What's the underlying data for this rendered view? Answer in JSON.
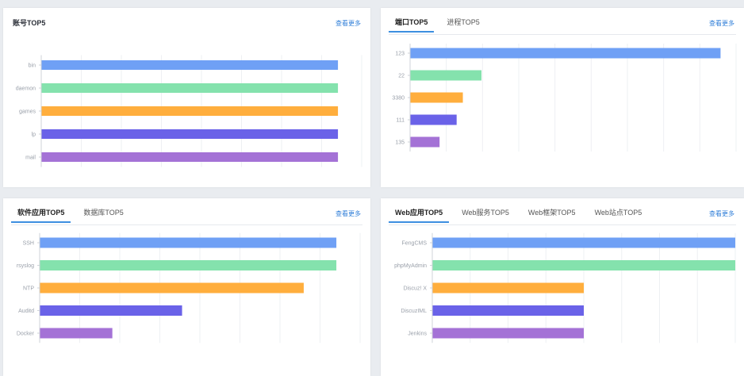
{
  "colors": [
    "#6fa0f5",
    "#84e2ad",
    "#ffae3d",
    "#6a62e8",
    "#a472d6"
  ],
  "panels": {
    "account": {
      "title": "账号TOP5",
      "more": "查看更多",
      "chart_data": {
        "type": "bar",
        "orientation": "horizontal",
        "categories": [
          "bin",
          "daemon",
          "games",
          "lp",
          "mail"
        ],
        "values": [
          100,
          100,
          100,
          100,
          100
        ],
        "xlim": [
          0,
          108
        ]
      }
    },
    "port": {
      "tabs": [
        "端口TOP5",
        "进程TOP5"
      ],
      "active_tab": 0,
      "more": "查看更多",
      "chart_data": {
        "type": "bar",
        "orientation": "horizontal",
        "categories": [
          "123",
          "22",
          "3380",
          "111",
          "135"
        ],
        "values": [
          100,
          23,
          17,
          15,
          9.5
        ],
        "xlim": [
          0,
          105
        ]
      }
    },
    "software": {
      "tabs": [
        "软件应用TOP5",
        "数据库TOP5"
      ],
      "active_tab": 0,
      "more": "查看更多",
      "chart_data": {
        "type": "bar",
        "orientation": "horizontal",
        "categories": [
          "SSH",
          "rsyslog",
          "NTP",
          "Auditd",
          "Docker"
        ],
        "values": [
          100,
          100,
          89,
          48,
          24.5
        ],
        "xlim": [
          0,
          108
        ]
      }
    },
    "web": {
      "tabs": [
        "Web应用TOP5",
        "Web服务TOP5",
        "Web框架TOP5",
        "Web站点TOP5"
      ],
      "active_tab": 0,
      "more": "查看更多",
      "chart_data": {
        "type": "bar",
        "orientation": "horizontal",
        "categories": [
          "FengCMS",
          "phpMyAdmin",
          "Discuz! X",
          "DiscuzIML",
          "Jenkins"
        ],
        "values": [
          100,
          100,
          50,
          50,
          50
        ],
        "xlim": [
          0,
          100
        ]
      }
    }
  }
}
